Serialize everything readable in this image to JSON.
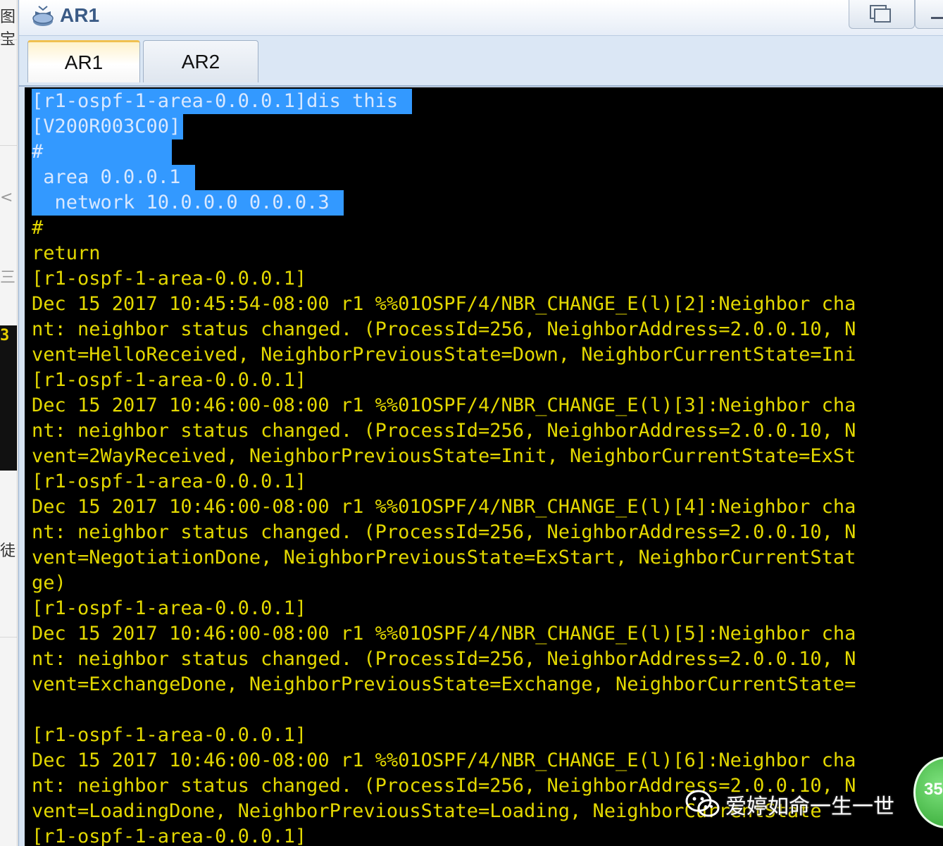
{
  "left_strip": {
    "fragments": [
      "图宝",
      "<",
      "三",
      "3",
      "徒"
    ]
  },
  "window": {
    "title": "AR1",
    "tabs": [
      {
        "label": "AR1",
        "active": true
      },
      {
        "label": "AR2",
        "active": false
      }
    ]
  },
  "terminal": {
    "lines": [
      {
        "text": "[r1-ospf-1-area-0.0.0.1]dis this ",
        "selected": true
      },
      {
        "text": "[V200R003C00]",
        "selected": true
      },
      {
        "text": "#           ",
        "selected": true
      },
      {
        "text": " area 0.0.0.1 ",
        "selected": true
      },
      {
        "text": "  network 10.0.0.0 0.0.0.3 ",
        "selected": true
      },
      {
        "text": "#",
        "selected": false
      },
      {
        "text": "return",
        "selected": false
      },
      {
        "text": "[r1-ospf-1-area-0.0.0.1]",
        "selected": false
      },
      {
        "text": "Dec 15 2017 10:45:54-08:00 r1 %%01OSPF/4/NBR_CHANGE_E(l)[2]:Neighbor cha",
        "selected": false
      },
      {
        "text": "nt: neighbor status changed. (ProcessId=256, NeighborAddress=2.0.0.10, N",
        "selected": false
      },
      {
        "text": "vent=HelloReceived, NeighborPreviousState=Down, NeighborCurrentState=Ini",
        "selected": false
      },
      {
        "text": "[r1-ospf-1-area-0.0.0.1]",
        "selected": false
      },
      {
        "text": "Dec 15 2017 10:46:00-08:00 r1 %%01OSPF/4/NBR_CHANGE_E(l)[3]:Neighbor cha",
        "selected": false
      },
      {
        "text": "nt: neighbor status changed. (ProcessId=256, NeighborAddress=2.0.0.10, N",
        "selected": false
      },
      {
        "text": "vent=2WayReceived, NeighborPreviousState=Init, NeighborCurrentState=ExSt",
        "selected": false
      },
      {
        "text": "[r1-ospf-1-area-0.0.0.1]",
        "selected": false
      },
      {
        "text": "Dec 15 2017 10:46:00-08:00 r1 %%01OSPF/4/NBR_CHANGE_E(l)[4]:Neighbor cha",
        "selected": false
      },
      {
        "text": "nt: neighbor status changed. (ProcessId=256, NeighborAddress=2.0.0.10, N",
        "selected": false
      },
      {
        "text": "vent=NegotiationDone, NeighborPreviousState=ExStart, NeighborCurrentStat",
        "selected": false
      },
      {
        "text": "ge)",
        "selected": false
      },
      {
        "text": "[r1-ospf-1-area-0.0.0.1]",
        "selected": false
      },
      {
        "text": "Dec 15 2017 10:46:00-08:00 r1 %%01OSPF/4/NBR_CHANGE_E(l)[5]:Neighbor cha",
        "selected": false
      },
      {
        "text": "nt: neighbor status changed. (ProcessId=256, NeighborAddress=2.0.0.10, N",
        "selected": false
      },
      {
        "text": "vent=ExchangeDone, NeighborPreviousState=Exchange, NeighborCurrentState=",
        "selected": false
      },
      {
        "text": "",
        "selected": false
      },
      {
        "text": "[r1-ospf-1-area-0.0.0.1]",
        "selected": false
      },
      {
        "text": "Dec 15 2017 10:46:00-08:00 r1 %%01OSPF/4/NBR_CHANGE_E(l)[6]:Neighbor cha",
        "selected": false
      },
      {
        "text": "nt: neighbor status changed. (ProcessId=256, NeighborAddress=2.0.0.10, N",
        "selected": false
      },
      {
        "text": "vent=LoadingDone, NeighborPreviousState=Loading, NeighborCurrentState",
        "selected": false
      },
      {
        "text": "[r1-ospf-1-area-0.0.0.1]",
        "selected": false
      }
    ],
    "colors": {
      "background": "#000000",
      "text": "#e3d800",
      "selection": "#3399ff"
    }
  },
  "watermark": {
    "text": "爱婷如命一生一世",
    "icon": "wechat-icon"
  },
  "badge": {
    "text": "35"
  }
}
